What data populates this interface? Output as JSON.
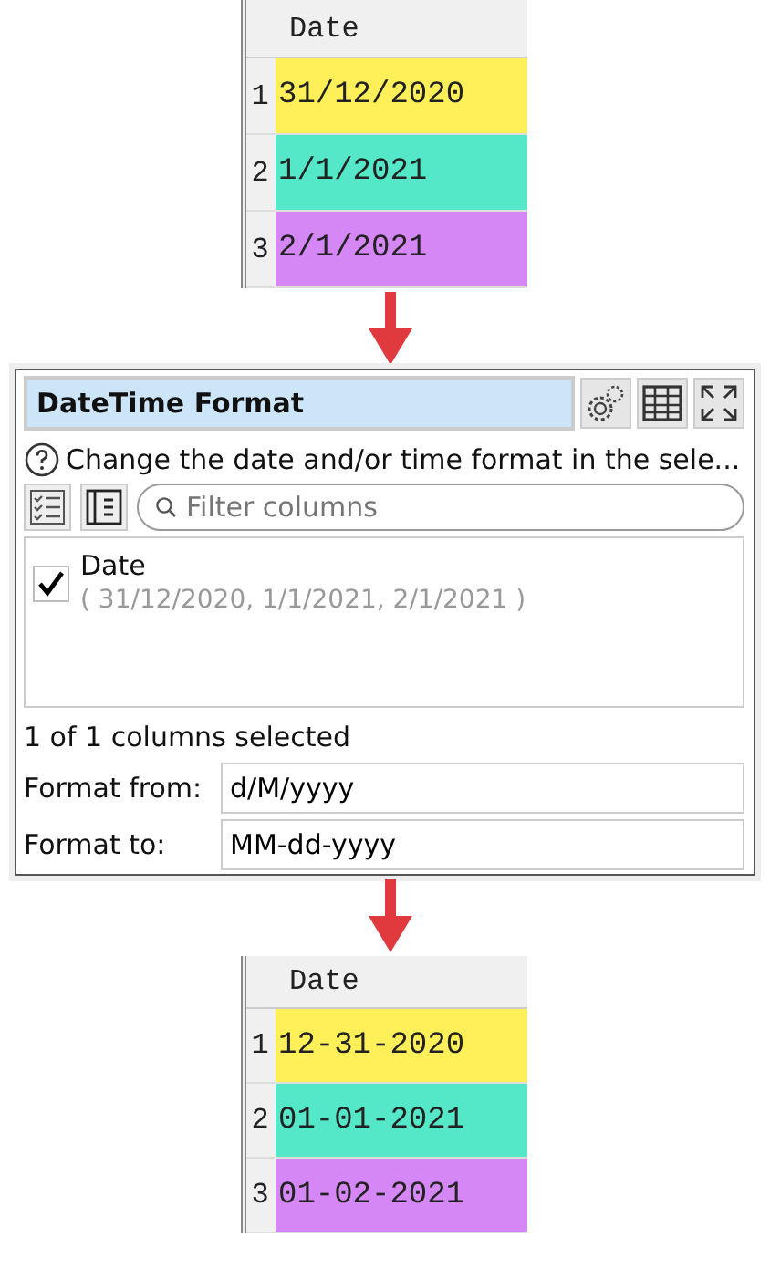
{
  "input_table": {
    "column": "Date",
    "rows": [
      {
        "number": "1",
        "value": "31/12/2020",
        "color": "#fff05a"
      },
      {
        "number": "2",
        "value": "1/1/2021",
        "color": "#55e8c8"
      },
      {
        "number": "3",
        "value": "2/1/2021",
        "color": "#d487f5"
      }
    ]
  },
  "panel": {
    "title": "DateTime Format",
    "help": "Change the date and/or time format in the sele...",
    "filter": {
      "placeholder": "Filter columns"
    },
    "columns": [
      {
        "name": "Date",
        "values": "( 31/12/2020, 1/1/2021, 2/1/2021 )",
        "checked": true
      }
    ],
    "status": "1 of 1 columns selected",
    "fields": [
      {
        "label": "Format from:",
        "value": "d/M/yyyy"
      },
      {
        "label": "Format to:",
        "value": "MM-dd-yyyy"
      }
    ]
  },
  "output_table": {
    "column": "Date",
    "rows": [
      {
        "number": "1",
        "value": "12-31-2020",
        "color": "#fff05a"
      },
      {
        "number": "2",
        "value": "01-01-2021",
        "color": "#55e8c8"
      },
      {
        "number": "3",
        "value": "01-02-2021",
        "color": "#d487f5"
      }
    ]
  }
}
